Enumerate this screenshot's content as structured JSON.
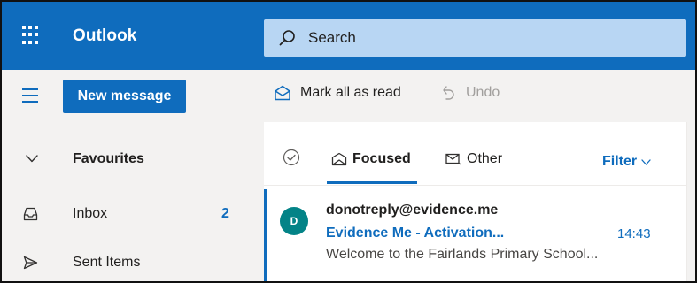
{
  "app": {
    "title": "Outlook"
  },
  "search": {
    "placeholder": "Search"
  },
  "command_bar": {
    "new_message_label": "New message",
    "mark_all_read_label": "Mark all as read",
    "undo_label": "Undo"
  },
  "nav": {
    "favourites_label": "Favourites",
    "items": [
      {
        "label": "Inbox",
        "count": "2"
      },
      {
        "label": "Sent Items",
        "count": ""
      }
    ]
  },
  "message_list": {
    "tabs": [
      {
        "label": "Focused",
        "selected": true
      },
      {
        "label": "Other",
        "selected": false
      }
    ],
    "filter_label": "Filter",
    "messages": [
      {
        "avatar_initial": "D",
        "sender": "donotreply@evidence.me",
        "subject": "Evidence Me - Activation...",
        "time": "14:43",
        "preview": "Welcome to the Fairlands Primary School..."
      }
    ]
  },
  "colors": {
    "brand": "#0f6cbd",
    "search_bg": "#b8d6f3",
    "nav_bg": "#f3f2f1",
    "avatar_bg": "#038387"
  },
  "icons": {
    "app_launcher": "waffle-icon",
    "search": "search-icon",
    "nav_toggle": "hamburger-icon",
    "mark_read": "envelope-open-icon",
    "undo": "undo-icon",
    "favourites_toggle": "chevron-down-icon",
    "inbox": "inbox-icon",
    "sent": "send-icon",
    "select_all": "check-circle-icon",
    "focused": "focused-icon",
    "other": "mail-icon",
    "filter": "chevron-down-icon"
  }
}
